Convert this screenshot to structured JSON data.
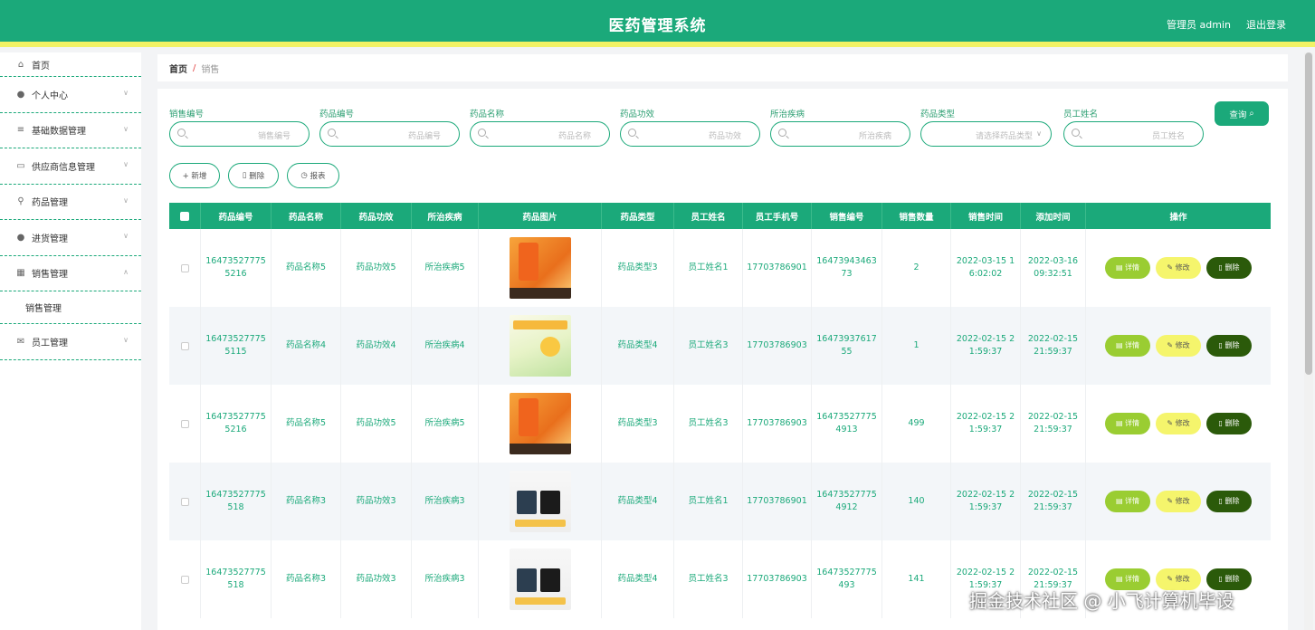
{
  "header": {
    "title": "医药管理系统",
    "user": "管理员 admin",
    "logout": "退出登录"
  },
  "sidebar": {
    "items": [
      {
        "label": "首页",
        "icon": "home-icon"
      },
      {
        "label": "个人中心",
        "icon": "user-icon"
      },
      {
        "label": "基础数据管理",
        "icon": "list-icon"
      },
      {
        "label": "供应商信息管理",
        "icon": "chat-icon"
      },
      {
        "label": "药品管理",
        "icon": "mic-icon"
      },
      {
        "label": "进货管理",
        "icon": "user-icon"
      },
      {
        "label": "销售管理",
        "icon": "grid-icon"
      },
      {
        "label": "员工管理",
        "icon": "mail-icon"
      }
    ],
    "submenu": "销售管理"
  },
  "breadcrumb": {
    "home": "首页",
    "sep": "/",
    "current": "销售"
  },
  "filters": [
    {
      "label": "销售编号",
      "placeholder": "销售编号"
    },
    {
      "label": "药品编号",
      "placeholder": "药品编号"
    },
    {
      "label": "药品名称",
      "placeholder": "药品名称"
    },
    {
      "label": "药品功效",
      "placeholder": "药品功效"
    },
    {
      "label": "所治疾病",
      "placeholder": "所治疾病"
    },
    {
      "label": "药品类型",
      "placeholder": "请选择药品类型"
    },
    {
      "label": "员工姓名",
      "placeholder": "员工姓名"
    }
  ],
  "query_btn": "查询",
  "actions": {
    "add": "+ 新增",
    "delete": "删除",
    "report": "报表"
  },
  "table": {
    "headers": [
      "药品编号",
      "药品名称",
      "药品功效",
      "所治疾病",
      "药品图片",
      "药品类型",
      "员工姓名",
      "员工手机号",
      "销售编号",
      "销售数量",
      "销售时间",
      "添加时间",
      "操作"
    ],
    "rows": [
      {
        "code": "164735277755216",
        "name": "药品名称5",
        "effect": "药品功效5",
        "disease": "所治疾病5",
        "img": "orange",
        "type": "药品类型3",
        "staff": "员工姓名1",
        "phone": "17703786901",
        "sale_no": "1647394346373",
        "qty": "2",
        "sale_time": "2022-03-15 16:02:02",
        "add_time": "2022-03-16 09:32:51"
      },
      {
        "code": "164735277755115",
        "name": "药品名称4",
        "effect": "药品功效4",
        "disease": "所治疾病4",
        "img": "green",
        "type": "药品类型4",
        "staff": "员工姓名3",
        "phone": "17703786903",
        "sale_no": "1647393761755",
        "qty": "1",
        "sale_time": "2022-02-15 21:59:37",
        "add_time": "2022-02-15 21:59:37"
      },
      {
        "code": "164735277755216",
        "name": "药品名称5",
        "effect": "药品功效5",
        "disease": "所治疾病5",
        "img": "orange",
        "type": "药品类型3",
        "staff": "员工姓名3",
        "phone": "17703786903",
        "sale_no": "164735277754913",
        "qty": "499",
        "sale_time": "2022-02-15 21:59:37",
        "add_time": "2022-02-15 21:59:37"
      },
      {
        "code": "16473527775518",
        "name": "药品名称3",
        "effect": "药品功效3",
        "disease": "所治疾病3",
        "img": "box",
        "type": "药品类型4",
        "staff": "员工姓名1",
        "phone": "17703786901",
        "sale_no": "164735277754912",
        "qty": "140",
        "sale_time": "2022-02-15 21:59:37",
        "add_time": "2022-02-15 21:59:37"
      },
      {
        "code": "16473527775518",
        "name": "药品名称3",
        "effect": "药品功效3",
        "disease": "所治疾病3",
        "img": "box",
        "type": "药品类型4",
        "staff": "员工姓名3",
        "phone": "17703786903",
        "sale_no": "16473527775493",
        "qty": "141",
        "sale_time": "2022-02-15 21:59:37",
        "add_time": "2022-02-15 21:59:37"
      }
    ],
    "ops": {
      "detail": "详情",
      "edit": "修改",
      "delete": "删除"
    }
  },
  "watermark": "掘金技术社区 @ 小飞计算机毕设",
  "colors": {
    "primary": "#1ba97a",
    "accent": "#f2f265",
    "detail": "#9acd32",
    "edit": "#f5f56c",
    "delete": "#2b5a0a"
  }
}
